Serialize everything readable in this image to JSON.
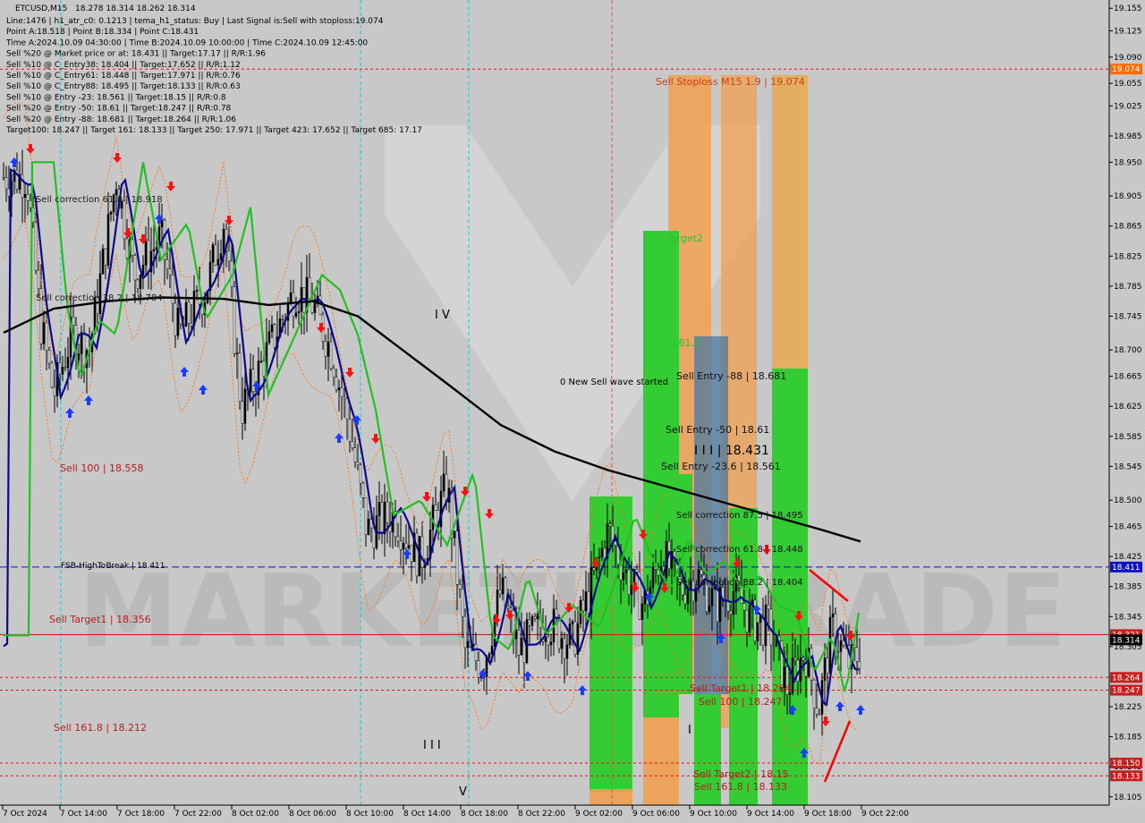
{
  "header": {
    "symbol": "ETCUSD,M15",
    "ohlc": "18.278 18.314 18.262 18.314",
    "info_lines": [
      "Line:1476 | h1_atr_c0: 0.1213 | tema_h1_status: Buy | Last Signal is:Sell with stoploss:19.074",
      "Point A:18.518 | Point B:18.334 | Point C:18.431",
      "Time A:2024.10.09 04:30:00 | Time B:2024.10.09 10:00:00 | Time C:2024.10.09 12:45:00",
      "Sell %20 @ Market price or at: 18.431 || Target:17.17 || R/R:1.96",
      "Sell %10 @ C_Entry38: 18.404 || Target:17.652 || R/R:1.12",
      "Sell %10 @ C_Entry61: 18.448 || Target:17.971 || R/R:0.76",
      "Sell %10 @ C_Entry88: 18.495 || Target:18.133 || R/R:0.63",
      "Sell %10 @ Entry -23: 18.561 || Target:18.15 || R/R:0.8",
      "Sell %20 @ Entry -50: 18.61 || Target:18.247 || R/R:0.78",
      "Sell %20 @ Entry -88: 18.681 || Target:18.264 || R/R:1.06",
      "Target100: 18.247 || Target 161: 18.133 || Target 250: 17.971 || Target 423: 17.652 || Target 685: 17.17"
    ]
  },
  "watermark": "MARKETIZ TRADE",
  "colors": {
    "background": "#c8c8c8",
    "bull_candle": "#000000",
    "ma_black": "#000000",
    "ma_green": "#22c022",
    "ma_blue": "#0a0a8c",
    "envelope": "#ff6a00",
    "blue_dashed": "#1010c8",
    "red_level": "#c81e1e",
    "stoploss_tag": "#ff6a00",
    "green_box": "#33cc33",
    "orange_box": "#f0a050",
    "steelblue_box": "#4a7aa0",
    "buy_arrow": "#1a3cff",
    "sell_arrow": "#ff1010"
  },
  "chart_data": {
    "type": "candlestick",
    "x_tick_labels": [
      "7 Oct 2024",
      "7 Oct 14:00",
      "7 Oct 18:00",
      "7 Oct 22:00",
      "8 Oct 02:00",
      "8 Oct 06:00",
      "8 Oct 10:00",
      "8 Oct 14:00",
      "8 Oct 18:00",
      "8 Oct 22:00",
      "9 Oct 02:00",
      "9 Oct 06:00",
      "9 Oct 10:00",
      "9 Oct 14:00",
      "9 Oct 18:00",
      "9 Oct 22:00"
    ],
    "y_tick_labels": [
      "19.155",
      "19.125",
      "19.090",
      "19.055",
      "19.025",
      "18.985",
      "18.950",
      "18.905",
      "18.865",
      "18.825",
      "18.785",
      "18.745",
      "18.700",
      "18.665",
      "18.625",
      "18.585",
      "18.545",
      "18.500",
      "18.465",
      "18.425",
      "18.385",
      "18.345",
      "18.305",
      "18.265",
      "18.225",
      "18.185",
      "18.145",
      "18.105"
    ],
    "ylim": [
      18.094,
      19.166
    ],
    "current_price": 18.314,
    "levels": [
      {
        "name": "stoploss",
        "price": 19.074,
        "tag": "19.074",
        "style": "dotted",
        "color": "#c81e1e"
      },
      {
        "name": "fsb",
        "price": 18.411,
        "tag": "18.411",
        "style": "dashed",
        "color": "#1010c8"
      },
      {
        "name": "price-red-line",
        "price": 18.321,
        "tag": "18.321",
        "style": "solid",
        "color": "#c81e1e"
      },
      {
        "name": "target-264",
        "price": 18.264,
        "tag": "18.264",
        "style": "dotted",
        "color": "#c81e1e"
      },
      {
        "name": "target-247",
        "price": 18.247,
        "tag": "18.247",
        "style": "dotted",
        "color": "#c81e1e"
      },
      {
        "name": "target-150",
        "price": 18.15,
        "tag": "18.150",
        "style": "dotted",
        "color": "#c81e1e"
      },
      {
        "name": "target-133",
        "price": 18.133,
        "tag": "18.133",
        "style": "dotted",
        "color": "#c81e1e"
      }
    ],
    "labels": {
      "fsb": "FSB-HighToBreak | 18.411",
      "sell_target1_left": "Sell Target1 | 18.356",
      "sell_100_left": "Sell 100 | 18.558",
      "sell_161_left": "Sell 161.8 | 18.212",
      "sell_correction_618_left": "Sell correction 61.8 | 18.918",
      "sell_correction_382_left": "Sell correction 38.2 | 18.784",
      "stoploss": "Sell Stoploss M15 1.9 | 19.074",
      "target2": "Target2",
      "l618": "l 61.8",
      "entry_88": "Sell Entry -88 | 18.681",
      "entry_50": "Sell Entry -50 | 18.61",
      "point_c": "I I I | 18.431",
      "entry_236": "Sell Entry -23.6 | 18.561",
      "corr_875": "Sell correction 87.5 | 18.495",
      "corr_618": "Sell correction 61.8 | 18.448",
      "corr_382": "Sell correction 38.2 | 18.404",
      "target1_right": "Sell Target1 | 18.264",
      "sell100_right": "Sell 100 | 18.247",
      "target2_right": "Sell Target2 | 18.15",
      "sell161_right": "Sell 161.8 | 18.133",
      "new_wave": "0 New Sell wave started",
      "wave_iv": "I V",
      "wave_iii": "I I I",
      "wave_v": "V",
      "wave_i": "I"
    }
  }
}
